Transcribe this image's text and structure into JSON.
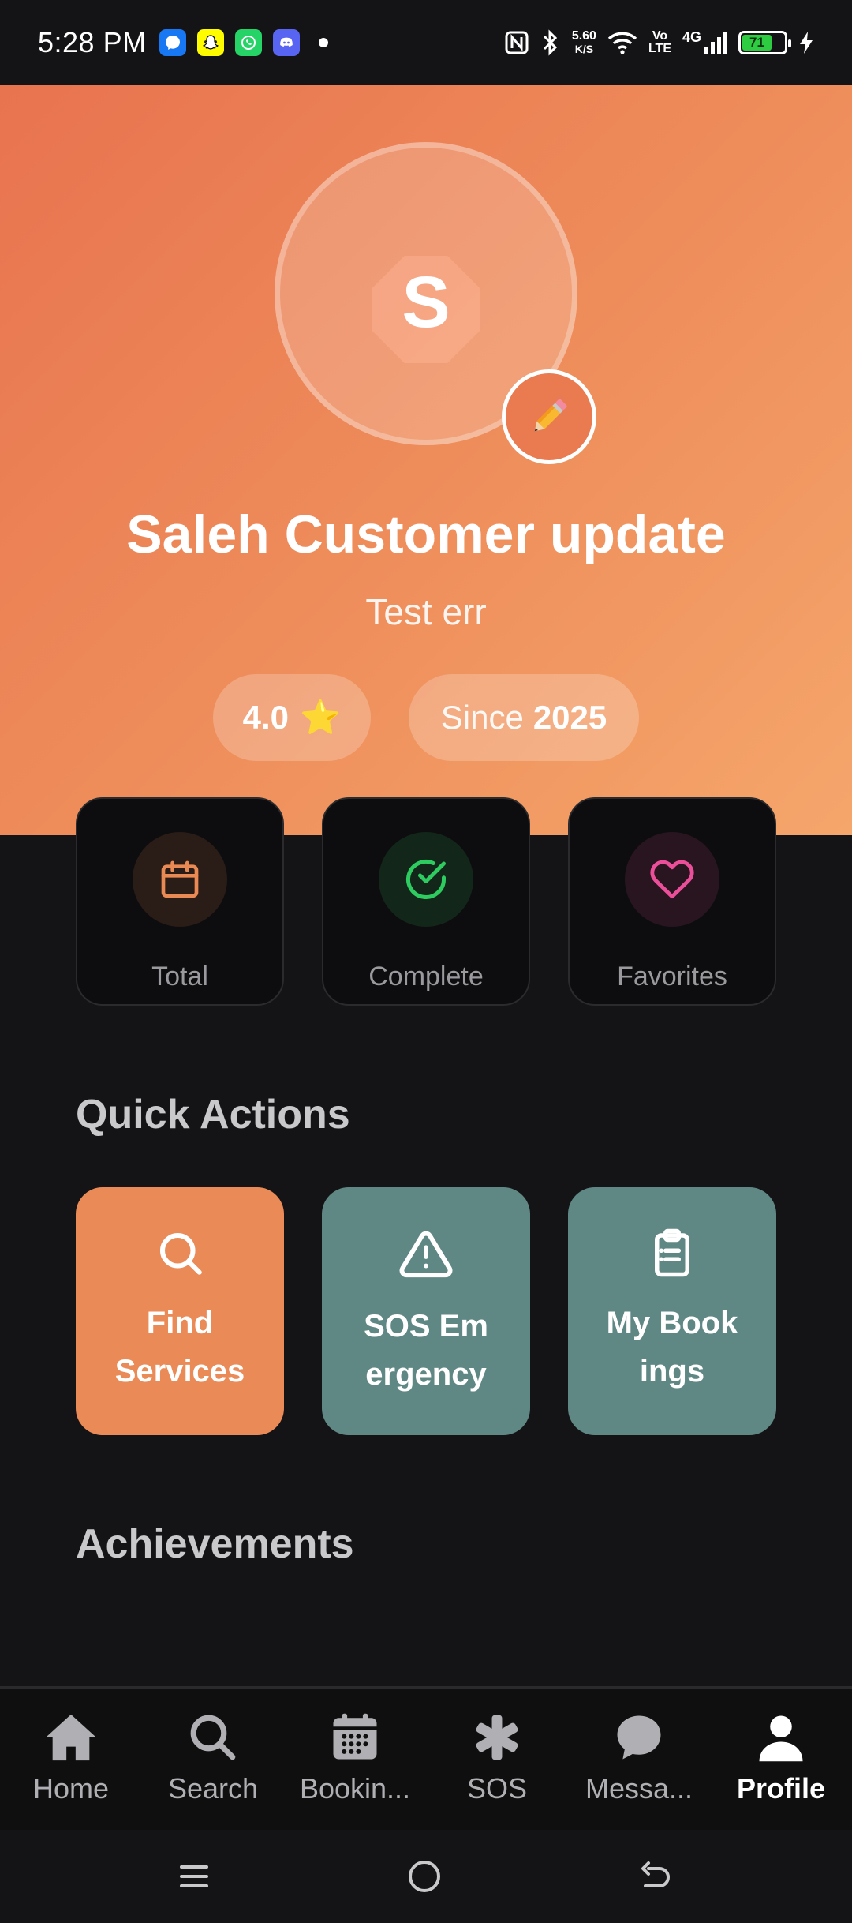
{
  "status_bar": {
    "time": "5:28 PM",
    "net_speed_value": "5.60",
    "net_speed_unit": "K/S",
    "volte_top": "Vo",
    "volte_bottom": "LTE",
    "network": "4G",
    "battery": "71",
    "notification_icons": [
      "messenger-icon",
      "snapchat-icon",
      "whatsapp-icon",
      "discord-icon"
    ]
  },
  "profile": {
    "avatar_letter": "S",
    "name": "Saleh Customer update",
    "subtitle": "Test err",
    "rating": "4.0",
    "rating_icon": "⭐",
    "since_label": "Since",
    "since_year": "2025",
    "edit_icon": "✏️"
  },
  "stats": [
    {
      "label": "Total",
      "icon": "calendar-icon",
      "color": "#e98a55"
    },
    {
      "label": "Complete",
      "icon": "check-circle-icon",
      "color": "#2ecc60"
    },
    {
      "label": "Favorites",
      "icon": "heart-icon",
      "color": "#ec4f9a"
    }
  ],
  "quick_actions": {
    "title": "Quick Actions",
    "items": [
      {
        "label": "Find\nServices",
        "icon": "search-icon",
        "color": "#ea8a56"
      },
      {
        "label": "SOS Em\nergency",
        "icon": "warning-icon",
        "color": "#5f8885"
      },
      {
        "label": "My Book\nings",
        "icon": "clipboard-list-icon",
        "color": "#5f8885"
      }
    ]
  },
  "achievements": {
    "title": "Achievements"
  },
  "bottom_nav": [
    {
      "label": "Home",
      "icon": "home-icon",
      "active": false
    },
    {
      "label": "Search",
      "icon": "search-icon",
      "active": false
    },
    {
      "label": "Bookin...",
      "icon": "calendar-grid-icon",
      "active": false
    },
    {
      "label": "SOS",
      "icon": "asterisk-icon",
      "active": false
    },
    {
      "label": "Messa...",
      "icon": "chat-bubble-icon",
      "active": false
    },
    {
      "label": "Profile",
      "icon": "person-icon",
      "active": true
    }
  ]
}
